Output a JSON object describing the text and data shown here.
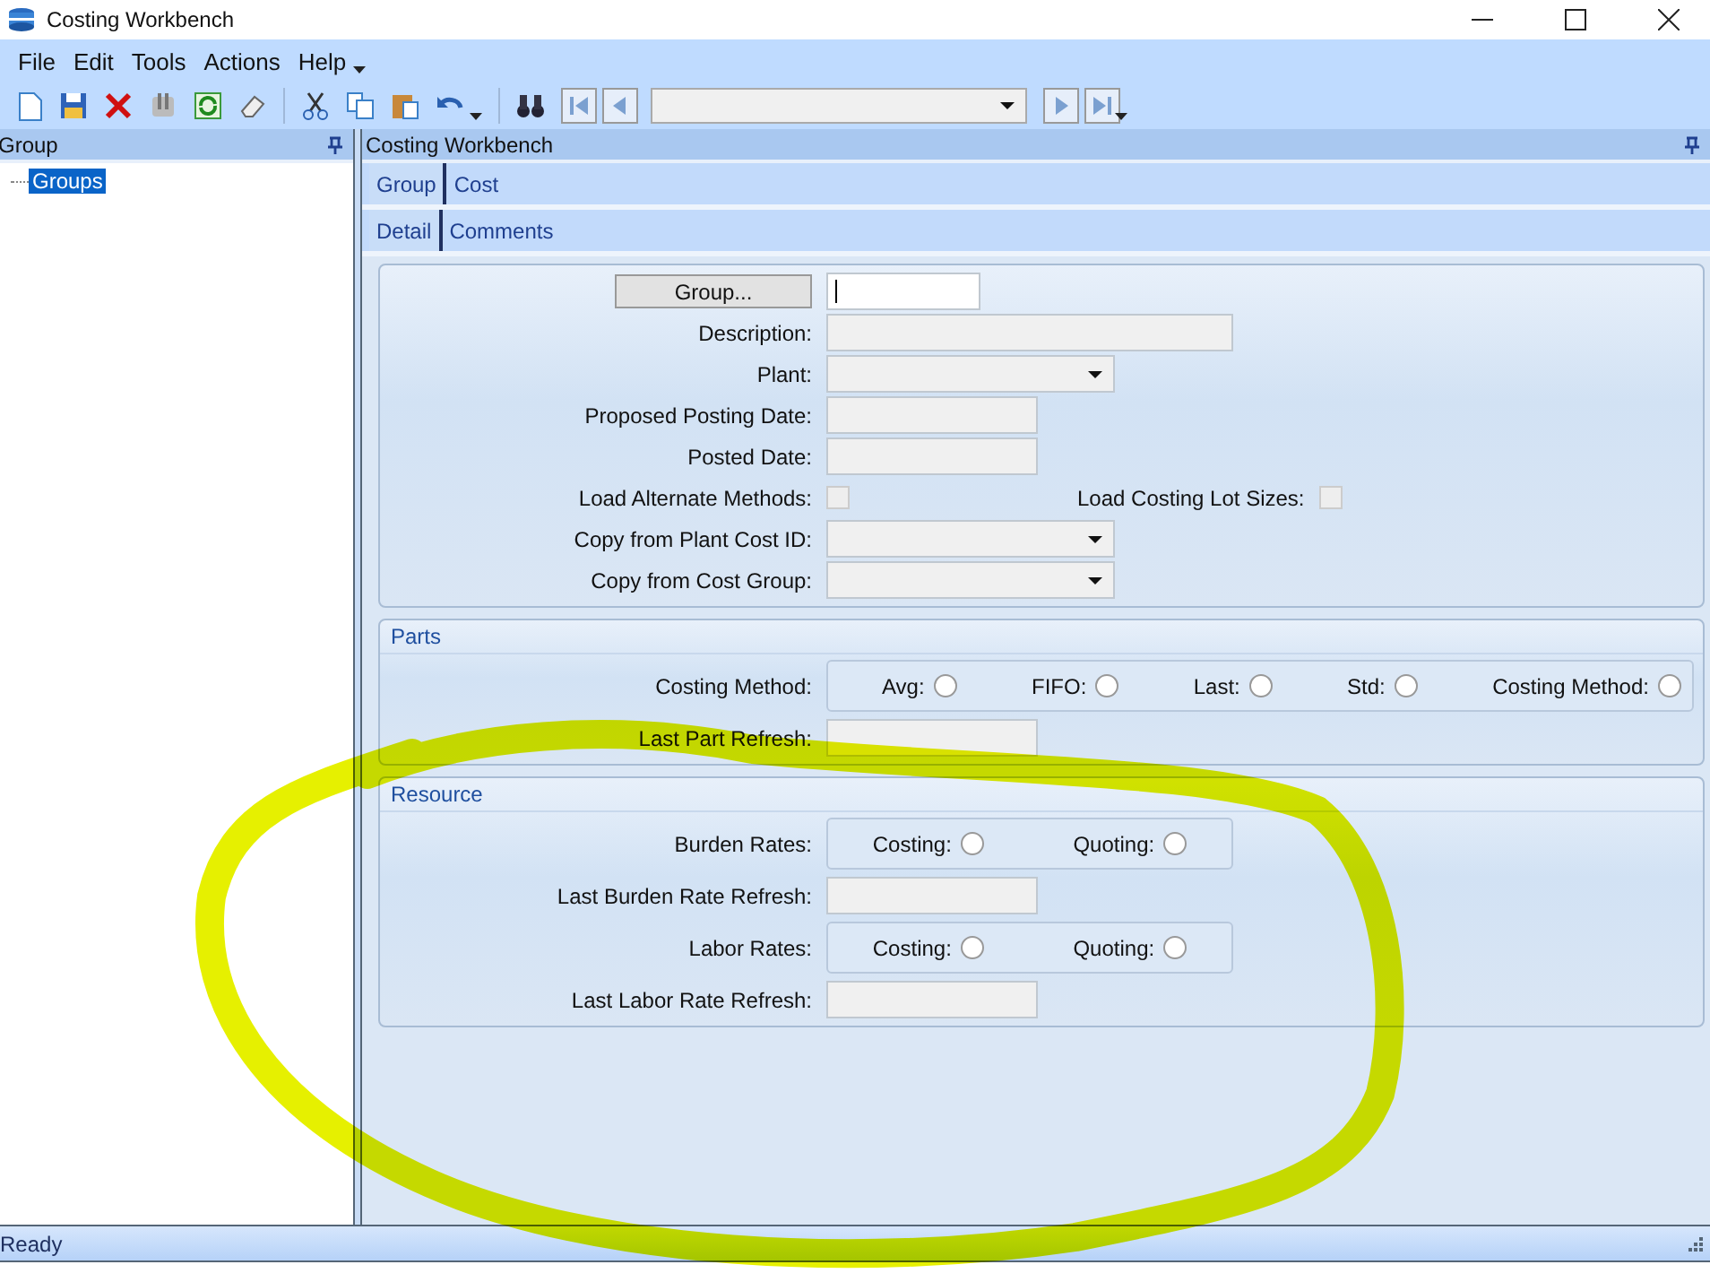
{
  "window": {
    "title": "Costing Workbench"
  },
  "menu": [
    "File",
    "Edit",
    "Tools",
    "Actions",
    "Help"
  ],
  "left_panel": {
    "title": "Group",
    "tree": [
      {
        "label": "Groups",
        "selected": true
      }
    ]
  },
  "main_panel": {
    "title": "Costing Workbench",
    "tabs": [
      {
        "label": "Group",
        "selected": true
      },
      {
        "label": "Cost",
        "selected": false
      }
    ],
    "subtabs": [
      {
        "label": "Detail",
        "selected": true
      },
      {
        "label": "Comments",
        "selected": false
      }
    ],
    "detail_fields": [
      {
        "kind": "lookup",
        "button": "Group..."
      },
      {
        "kind": "text",
        "label": "Description:"
      },
      {
        "kind": "dropdown",
        "label": "Plant:"
      },
      {
        "kind": "date",
        "label": "Proposed Posting Date:"
      },
      {
        "kind": "date",
        "label": "Posted Date:"
      },
      {
        "kind": "checks",
        "items": [
          {
            "label": "Load Alternate Methods:",
            "checked": false
          },
          {
            "label": "Load Costing Lot Sizes:",
            "checked": false
          }
        ]
      },
      {
        "kind": "dropdown",
        "label": "Copy from Plant Cost ID:"
      },
      {
        "kind": "dropdown",
        "label": "Copy from Cost Group:"
      }
    ],
    "groups": [
      {
        "title": "Parts",
        "fields": [
          {
            "kind": "radios",
            "label": "Costing Method:",
            "wide": true,
            "options": [
              {
                "label": "Avg:",
                "selected": false
              },
              {
                "label": "FIFO:",
                "selected": false
              },
              {
                "label": "Last:",
                "selected": false
              },
              {
                "label": "Std:",
                "selected": false
              },
              {
                "label": "Costing Method:",
                "selected": false
              }
            ]
          },
          {
            "kind": "date",
            "label": "Last Part Refresh:"
          }
        ]
      },
      {
        "title": "Resource",
        "fields": [
          {
            "kind": "radios",
            "label": "Burden Rates:",
            "wide": false,
            "options": [
              {
                "label": "Costing:",
                "selected": false
              },
              {
                "label": "Quoting:",
                "selected": false
              }
            ]
          },
          {
            "kind": "date",
            "label": "Last Burden Rate Refresh:"
          },
          {
            "kind": "radios",
            "label": "Labor Rates:",
            "wide": false,
            "options": [
              {
                "label": "Costing:",
                "selected": false
              },
              {
                "label": "Quoting:",
                "selected": false
              }
            ]
          },
          {
            "kind": "date",
            "label": "Last Labor Rate Refresh:"
          }
        ]
      }
    ]
  },
  "status_bar": {
    "text": "Ready"
  }
}
